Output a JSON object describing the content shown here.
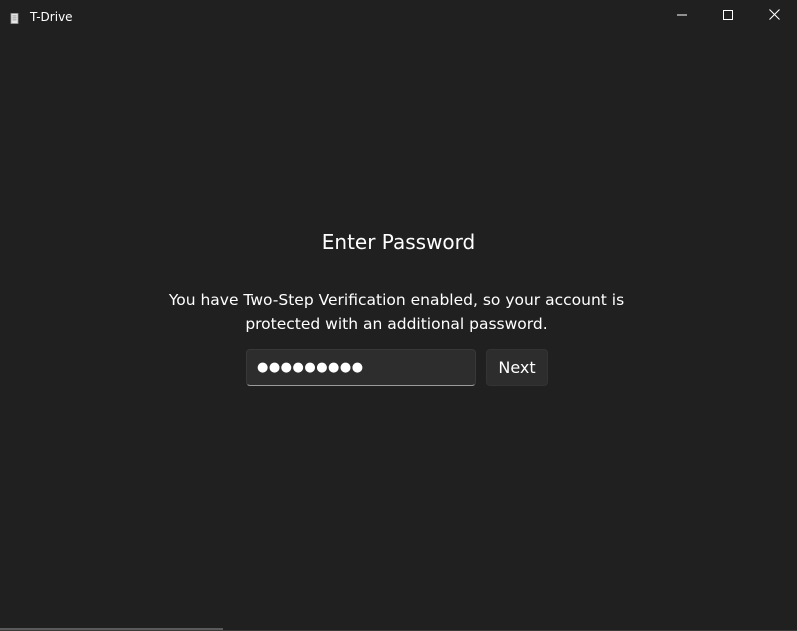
{
  "window": {
    "title": "T-Drive",
    "icon": "document-icon",
    "controls": [
      "minimize-icon",
      "maximize-icon",
      "close-icon"
    ]
  },
  "login": {
    "heading": "Enter Password",
    "description": "You have Two-Step Verification enabled, so your account is protected with an additional password.",
    "password_masked": "●●●●●●●●●",
    "next_label": "Next"
  },
  "colors": {
    "background": "#202020",
    "control_background": "#2d2d2d",
    "text": "#ffffff"
  }
}
